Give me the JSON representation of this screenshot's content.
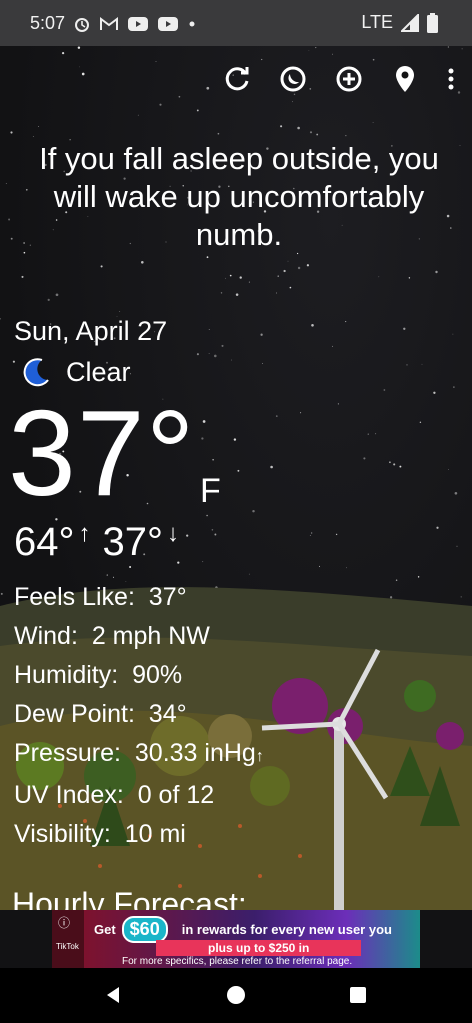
{
  "status_bar": {
    "time": "5:07",
    "network": "LTE",
    "icons": [
      "alarm-icon",
      "gmail-icon",
      "youtube-icon",
      "youtube-icon",
      "dot-icon",
      "signal-icon",
      "battery-icon"
    ]
  },
  "toolbar": {
    "icons": [
      "refresh-icon",
      "theme-icon",
      "add-icon",
      "location-icon",
      "more-icon"
    ]
  },
  "quote": "If you fall asleep outside, you will wake up uncomfortably numb.",
  "weather": {
    "date": "Sun, April 27",
    "condition": "Clear",
    "condition_icon": "moon-icon",
    "temperature": "37°",
    "unit": "F",
    "high": "64°",
    "low": "37°"
  },
  "details": [
    {
      "label": "Feels Like:",
      "value": "37°"
    },
    {
      "label": "Wind:",
      "value": "2 mph NW"
    },
    {
      "label": "Humidity:",
      "value": "90%"
    },
    {
      "label": "Dew Point:",
      "value": "34°"
    },
    {
      "label": "Pressure:",
      "value": "30.33 inHg"
    },
    {
      "label": "UV Index:",
      "value": "0 of 12"
    },
    {
      "label": "Visibility:",
      "value": "10 mi"
    }
  ],
  "hourly_heading": "Hourly Forecast:",
  "ad": {
    "brand": "TikTok",
    "get": "Get",
    "amount": "$60",
    "headline": "in rewards for every new user you",
    "plus": "plus up to $250 in",
    "footer": "For more specifics, please refer to the referral page."
  },
  "colors": {
    "background": "#121214",
    "status_bar": "#3a3a3c",
    "moon": "#1f5fd8"
  }
}
